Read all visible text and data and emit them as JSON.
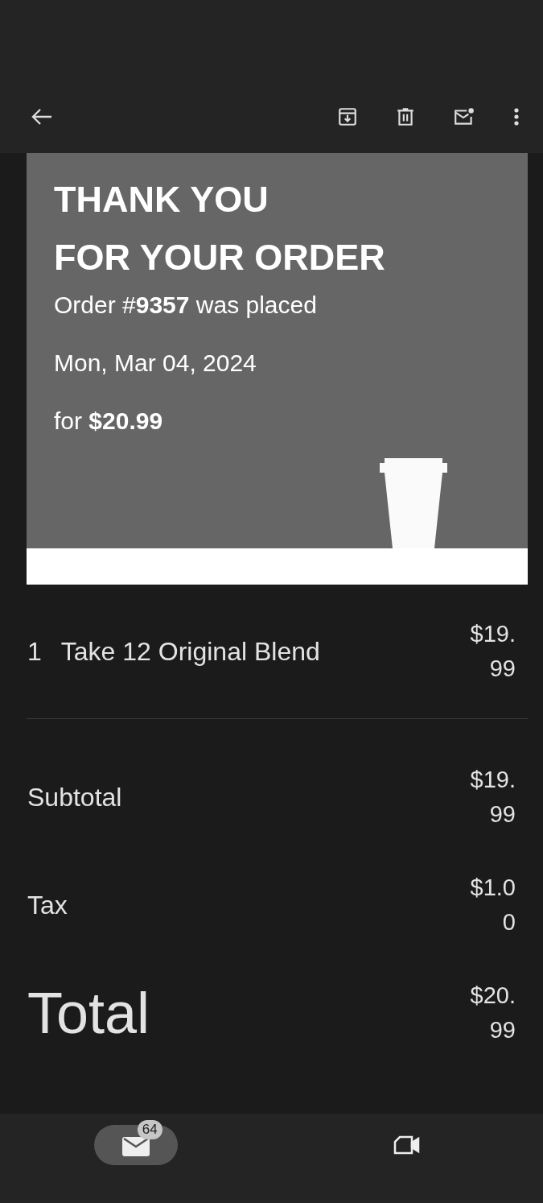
{
  "toolbar": {
    "actions": [
      {
        "kind": "archive"
      },
      {
        "kind": "delete"
      },
      {
        "kind": "unread"
      },
      {
        "kind": "more"
      }
    ]
  },
  "banner": {
    "title_lines": [
      "THANK YOU",
      "FOR YOUR ORDER"
    ],
    "lines": [
      "Order #**9357** was placed",
      "Mon, Mar 04, 2024",
      "for **$20.99**"
    ]
  },
  "items": [
    {
      "quantity": "1",
      "name": "Take 12 Original Blend",
      "price": "$19.99"
    }
  ],
  "summary": [
    {
      "kind": "normal",
      "label": "Subtotal",
      "amount": "$19.99"
    },
    {
      "kind": "normal",
      "label": "Tax",
      "amount": "$1.00"
    },
    {
      "kind": "total",
      "label": "Total",
      "amount": "$20.99"
    }
  ],
  "bottom_nav": [
    {
      "kind": "mail",
      "selected": true,
      "badge": "64"
    },
    {
      "kind": "video",
      "selected": false
    }
  ]
}
